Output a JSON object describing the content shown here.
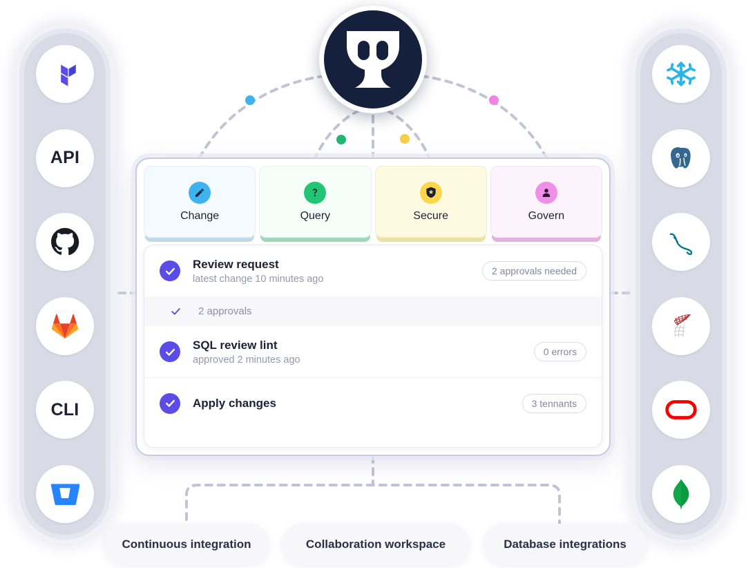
{
  "hub": {
    "name": "bytebase-logo",
    "bg_color": "#15203c"
  },
  "left_rail": {
    "name": "ci-integrations-rail",
    "items": [
      {
        "icon": "terraform-icon",
        "label": "",
        "type": "icon"
      },
      {
        "icon": "api-icon",
        "label": "API",
        "type": "text"
      },
      {
        "icon": "github-icon",
        "label": "",
        "type": "icon"
      },
      {
        "icon": "gitlab-icon",
        "label": "",
        "type": "icon"
      },
      {
        "icon": "cli-icon",
        "label": "CLI",
        "type": "text"
      },
      {
        "icon": "bitbucket-icon",
        "label": "",
        "type": "icon"
      }
    ]
  },
  "right_rail": {
    "name": "database-integrations-rail",
    "items": [
      {
        "icon": "snowflake-icon",
        "label": "",
        "type": "icon"
      },
      {
        "icon": "postgresql-icon",
        "label": "",
        "type": "icon"
      },
      {
        "icon": "mysql-icon",
        "label": "",
        "type": "icon"
      },
      {
        "icon": "sqlserver-icon",
        "label": "",
        "type": "icon"
      },
      {
        "icon": "oracle-icon",
        "label": "",
        "type": "icon"
      },
      {
        "icon": "mongodb-icon",
        "label": "",
        "type": "icon"
      }
    ]
  },
  "pillars": [
    {
      "label": "Change",
      "icon": "pencil-icon",
      "icon_bg": "#3eb3ef",
      "card_bg": "#f4fbfe",
      "outer_bg": "#bfdbea",
      "dot_color": "#3eb3ef"
    },
    {
      "label": "Query",
      "icon": "question-icon",
      "icon_bg": "#22c573",
      "card_bg": "#f6fefa",
      "outer_bg": "#9fd9bb",
      "dot_color": "#22b573"
    },
    {
      "label": "Secure",
      "icon": "shield-icon",
      "icon_bg": "#fcd74d",
      "card_bg": "#fdfae1",
      "outer_bg": "#ece3a3",
      "dot_color": "#f5cf47"
    },
    {
      "label": "Govern",
      "icon": "user-icon",
      "icon_bg": "#ef8fe8",
      "card_bg": "#fdf3fc",
      "outer_bg": "#e3b1de",
      "dot_color": "#ee84e4"
    }
  ],
  "checklist": {
    "name": "workflow-checklist",
    "rows": [
      {
        "kind": "main",
        "title": "Review request",
        "subtitle": "latest change 10 minutes ago",
        "badge": "2 approvals needed"
      },
      {
        "kind": "sub",
        "title": "2 approvals",
        "subtitle": "",
        "badge": ""
      },
      {
        "kind": "main",
        "title": "SQL review lint",
        "subtitle": "approved 2 minutes ago",
        "badge": "0 errors"
      },
      {
        "kind": "main",
        "title": "Apply changes",
        "subtitle": "",
        "badge": "3 tennants"
      }
    ]
  },
  "footer_pills": [
    {
      "label": "Continuous integration"
    },
    {
      "label": "Collaboration workspace"
    },
    {
      "label": "Database integrations"
    }
  ],
  "colors": {
    "accent_purple": "#5b4ce8",
    "rail_bg": "#d9dae6",
    "panel_border": "#c9c9e2",
    "wire": "#c2c3d4",
    "hub_bg": "#15203c"
  }
}
